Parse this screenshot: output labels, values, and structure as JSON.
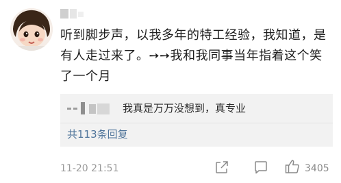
{
  "comment": {
    "text": "听到脚步声，以我多年的特工经验，我知道，是有人走过来了。➙➙我和我同事当年指着这个笑了一个月",
    "timestamp": "11-20 21:51",
    "like_count": "3405"
  },
  "reply": {
    "text": "我真是万万没想到，真专业",
    "more_link": "共113条回复"
  },
  "icons": {
    "share": "share-icon",
    "comment": "comment-icon",
    "like": "thumbs-up-icon"
  },
  "colors": {
    "link": "#50759b",
    "reply_bg": "#f2f2f2",
    "meta_text": "#9a9a9a"
  }
}
